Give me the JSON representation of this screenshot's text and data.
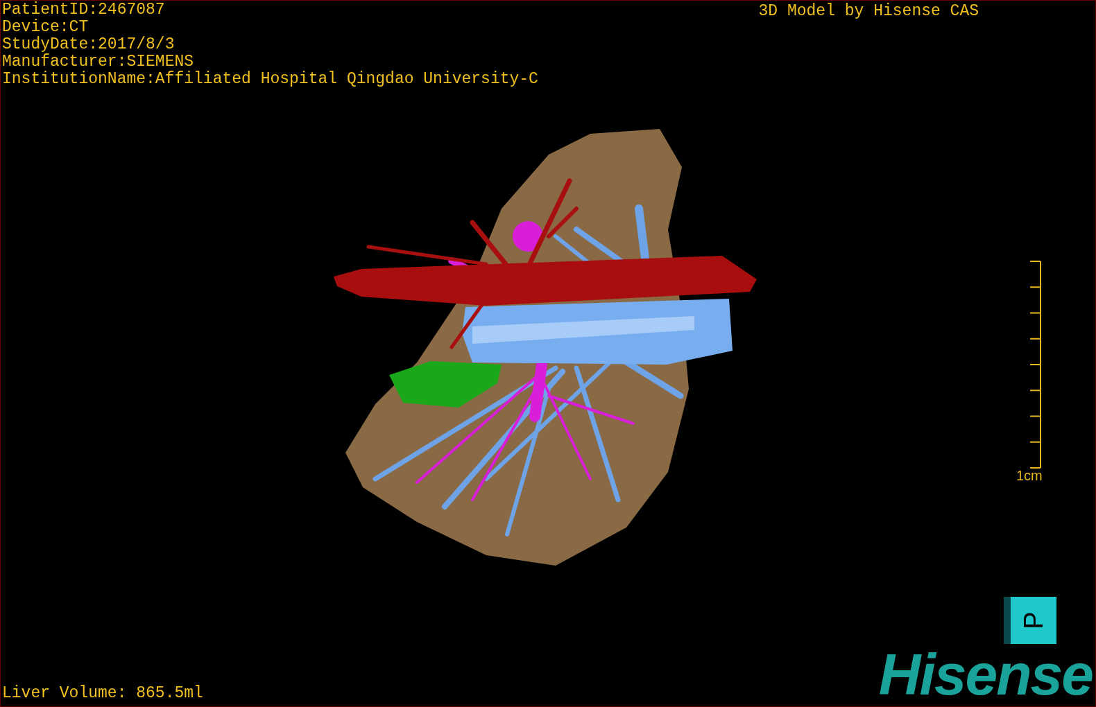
{
  "viewport": {
    "patient_info": [
      "PatientID:2467087",
      "Device:CT",
      "StudyDate:2017/8/3",
      "Manufacturer:SIEMENS",
      "InstitutionName:Affiliated Hospital Qingdao University-C"
    ],
    "title": "3D Model by Hisense CAS",
    "scale_bar": {
      "label": "1cm"
    },
    "orientation_cube": {
      "label": "P"
    },
    "volume": "Liver Volume: 865.5ml",
    "logo": "Hisense"
  }
}
